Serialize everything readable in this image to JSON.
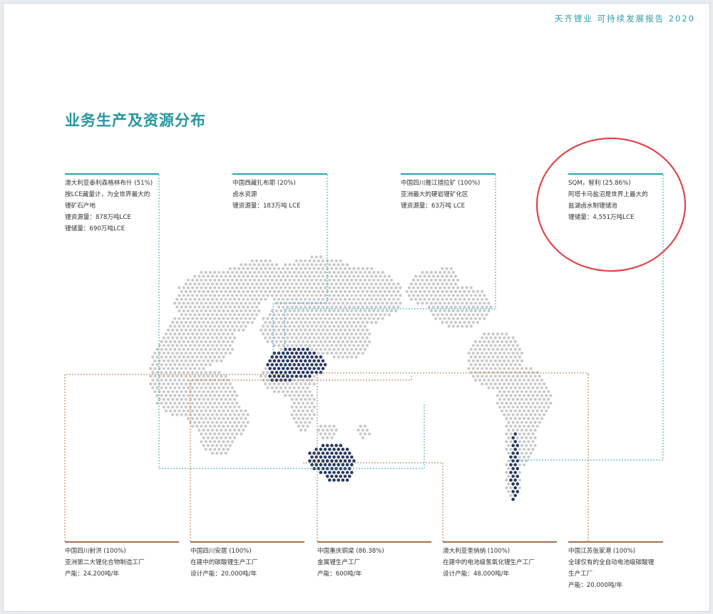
{
  "header": "天齐锂业  可持续发展报告  2020",
  "title": "业务生产及资源分布",
  "colors": {
    "accent": "#2796a0",
    "top_rule": "#2aa3ad",
    "bottom_rule": "#a07050",
    "dot_land": "#c9c9c9",
    "dot_highlight": "#2b3a5e",
    "circle": "#e0474c"
  },
  "top_blocks": [
    {
      "lines": [
        "澳大利亚泰利森格林布什 (51%)",
        "按LCE藏量计，为全世界最大的",
        "锂矿石产地",
        "锂资源量：878万吨LCE",
        "锂储量：690万吨LCE"
      ]
    },
    {
      "lines": [
        "中国西藏扎布耶 (20%)",
        "卤水资源",
        "锂资源量：183万吨 LCE"
      ]
    },
    {
      "lines": [
        "中国四川雅江措拉矿 (100%)",
        "亚洲最大的硬岩锂矿化区",
        "锂资源量：63万吨 LCE"
      ]
    },
    {
      "lines": [
        "SQM，智利 (25.86%)",
        "阿塔卡马盐沼是世界上最大的",
        "盐湖卤水制锂储池",
        "锂储量：4,551万吨LCE"
      ]
    }
  ],
  "bottom_blocks": [
    {
      "lines": [
        "中国四川射洪 (100%)",
        "亚洲第二大锂化合物制造工厂",
        "产能：24,200吨/年"
      ]
    },
    {
      "lines": [
        "中国四川安居 (100%)",
        "在建中的碳酸锂生产工厂",
        "设计产能：20,000吨/年"
      ]
    },
    {
      "lines": [
        "中国重庆铜梁 (86.38%)",
        "金属锂生产工厂",
        "产能：600吨/年"
      ]
    },
    {
      "lines": [
        "澳大利亚奎纳纳 (100%)",
        "在建中的电池级氢氧化锂生产工厂",
        "设计产能：48,000吨/年"
      ]
    },
    {
      "lines": [
        "中国江苏张家港 (100%)",
        "全球仅有的全自动电池级碳酸锂",
        "生产工厂",
        "产能：20,000吨/年"
      ]
    }
  ]
}
